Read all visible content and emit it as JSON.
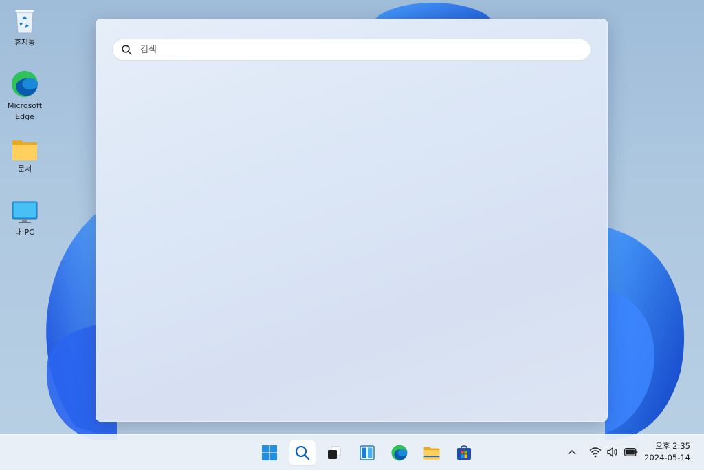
{
  "desktop": {
    "icons": [
      {
        "label": "휴지통",
        "icon": "recycle-bin-icon"
      },
      {
        "label": "Microsoft Edge",
        "icon": "edge-icon"
      },
      {
        "label": "문서",
        "icon": "folder-icon"
      },
      {
        "label": "내 PC",
        "icon": "monitor-icon"
      }
    ]
  },
  "search_panel": {
    "placeholder": "검색",
    "value": ""
  },
  "taskbar": {
    "apps": [
      {
        "name": "start",
        "icon": "windows-start-icon"
      },
      {
        "name": "search",
        "icon": "search-icon",
        "active": true
      },
      {
        "name": "task-view",
        "icon": "task-view-icon"
      },
      {
        "name": "widgets",
        "icon": "widgets-icon"
      },
      {
        "name": "edge",
        "icon": "edge-icon"
      },
      {
        "name": "file-explorer",
        "icon": "folder-icon"
      },
      {
        "name": "store",
        "icon": "store-icon"
      }
    ],
    "tray": [
      "chevron-up-icon",
      "wifi-icon",
      "volume-icon",
      "battery-icon"
    ],
    "clock": {
      "time": "오후 2:35",
      "date": "2024-05-14"
    }
  },
  "colors": {
    "accent": "#0f6cbd",
    "wallpaper_bloom": "#1f5ee8"
  }
}
